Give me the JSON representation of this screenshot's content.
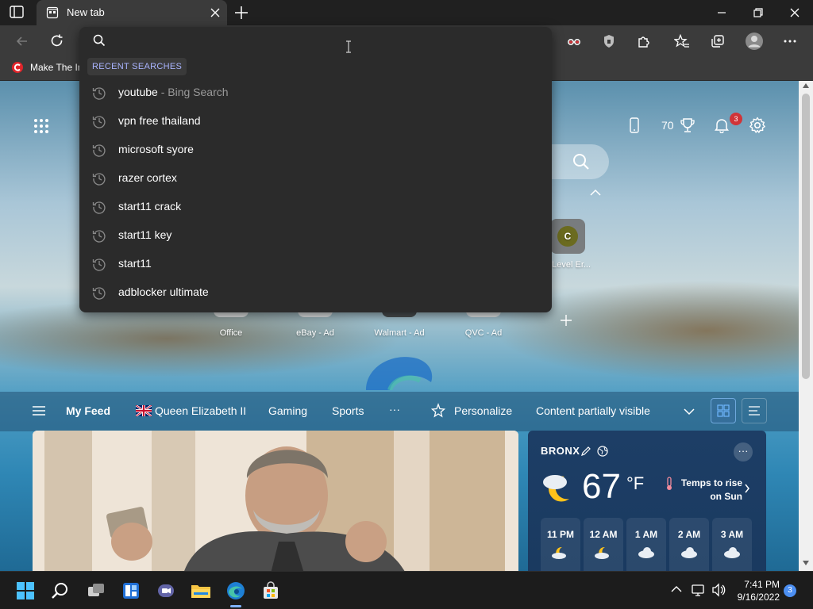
{
  "tab": {
    "title": "New tab"
  },
  "favorites": {
    "item_label": "Make The In"
  },
  "omnibox": {
    "query": "",
    "section_label": "RECENT SEARCHES",
    "items": [
      {
        "text": "youtube",
        "sub": " - Bing Search"
      },
      {
        "text": "vpn free thailand",
        "sub": ""
      },
      {
        "text": "microsoft syore",
        "sub": ""
      },
      {
        "text": "razer cortex",
        "sub": ""
      },
      {
        "text": "start11 crack",
        "sub": ""
      },
      {
        "text": "start11 key",
        "sub": ""
      },
      {
        "text": "start11",
        "sub": ""
      },
      {
        "text": "adblocker ultimate",
        "sub": ""
      }
    ]
  },
  "newtab": {
    "rewards_points": "70",
    "notifications_count": "3",
    "quick_links": [
      {
        "label": "0 Level Er...",
        "letter": "C"
      },
      {
        "label": "Office"
      },
      {
        "label": "eBay - Ad"
      },
      {
        "label": "Walmart - Ad"
      },
      {
        "label": "QVC - Ad"
      }
    ]
  },
  "feed_nav": {
    "my_feed": "My Feed",
    "topic1": "Queen Elizabeth II",
    "topic2": "Gaming",
    "topic3": "Sports",
    "more": "···",
    "personalize": "Personalize",
    "content_visibility": "Content partially visible"
  },
  "weather": {
    "city": "BRONX",
    "temp": "67",
    "unit": "°F",
    "note": "Temps to rise on Sun",
    "hours": [
      "11 PM",
      "12 AM",
      "1 AM",
      "2 AM",
      "3 AM"
    ],
    "menu": "···"
  },
  "taskbar": {
    "time": "7:41 PM",
    "date": "9/16/2022",
    "notification_count": "3"
  },
  "colors": {
    "omnibox_bg": "#2b2b2b",
    "section_label": "#a9b4ff",
    "notification_badge": "#d13438",
    "taskbar_accent": "#7fb2ff"
  },
  "icons": {
    "tab": "tab-actions-icon",
    "favicon": "newtab-favicon",
    "search": "search-icon",
    "history": "history-clock-icon",
    "gear": "gear-icon",
    "bell": "bell-icon",
    "trophy": "rewards-icon"
  }
}
